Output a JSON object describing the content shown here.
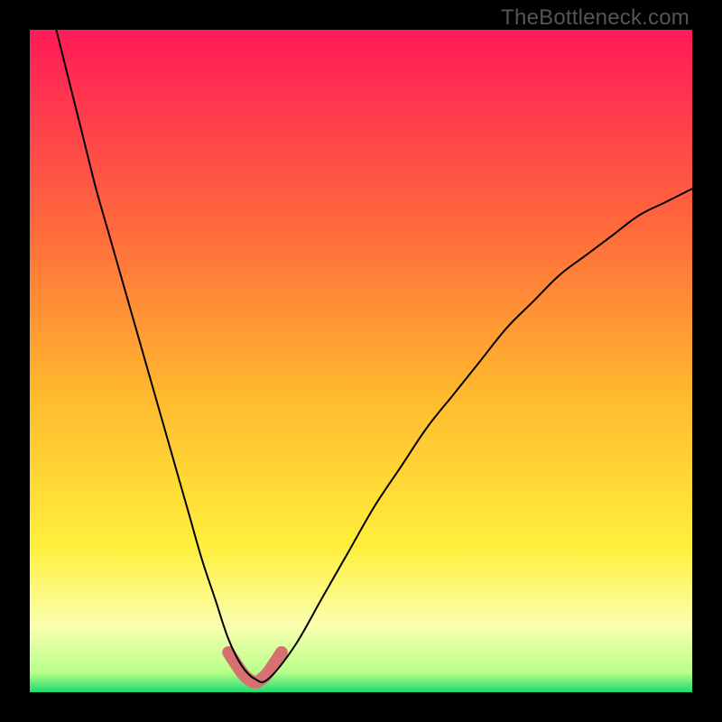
{
  "watermark": "TheBottleneck.com",
  "chart_data": {
    "type": "line",
    "title": "",
    "xlabel": "",
    "ylabel": "",
    "xlim": [
      0,
      100
    ],
    "ylim": [
      0,
      100
    ],
    "grid": false,
    "legend": false,
    "series": [
      {
        "name": "bottleneck-curve",
        "x": [
          4,
          6,
          8,
          10,
          12,
          14,
          16,
          18,
          20,
          22,
          24,
          26,
          28,
          30,
          32,
          34,
          36,
          40,
          44,
          48,
          52,
          56,
          60,
          64,
          68,
          72,
          76,
          80,
          84,
          88,
          92,
          96,
          100
        ],
        "y": [
          100,
          92,
          84,
          76,
          69,
          62,
          55,
          48,
          41,
          34,
          27,
          20,
          14,
          8,
          4,
          2,
          2,
          7,
          14,
          21,
          28,
          34,
          40,
          45,
          50,
          55,
          59,
          63,
          66,
          69,
          72,
          74,
          76
        ]
      },
      {
        "name": "optimal-band",
        "x": [
          30,
          32,
          33,
          34,
          35,
          36,
          38
        ],
        "y": [
          6,
          3,
          2,
          1.5,
          2,
          3,
          6
        ]
      }
    ],
    "background_gradient": {
      "stops": [
        {
          "offset": 0.0,
          "color": "#ff1a58"
        },
        {
          "offset": 0.3,
          "color": "#ff6a3c"
        },
        {
          "offset": 0.55,
          "color": "#ffb92e"
        },
        {
          "offset": 0.78,
          "color": "#ffef3c"
        },
        {
          "offset": 0.9,
          "color": "#faffb0"
        },
        {
          "offset": 0.97,
          "color": "#b8ff8a"
        },
        {
          "offset": 1.0,
          "color": "#1ed96e"
        }
      ]
    },
    "colors": {
      "curve": "#000000",
      "band": "#d77070"
    }
  }
}
